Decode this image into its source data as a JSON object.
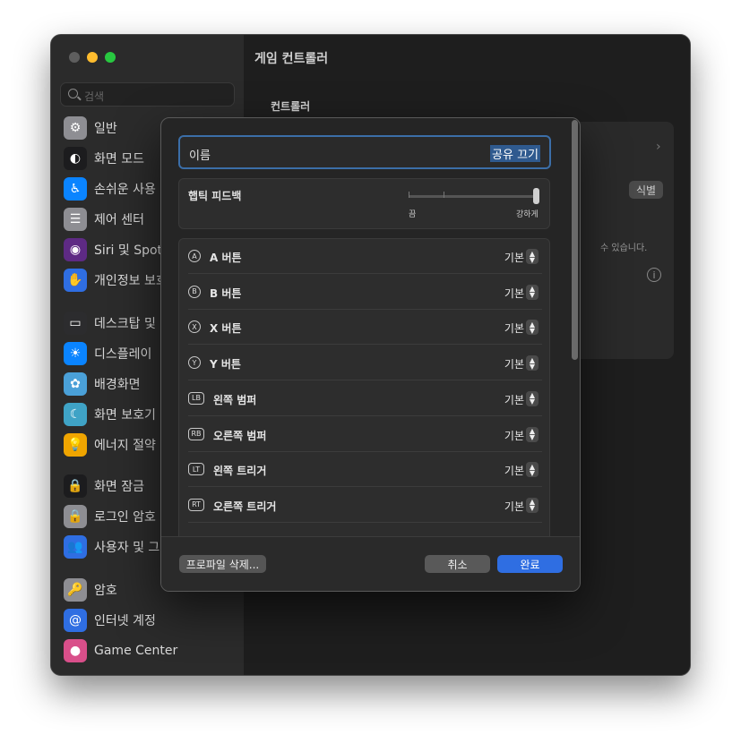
{
  "window": {
    "title": "게임 컨트롤러"
  },
  "sidebar": {
    "search_placeholder": "검색",
    "items": [
      {
        "label": "일반",
        "icon": "gear-icon",
        "color": "#8e8e93",
        "glyph": "⚙"
      },
      {
        "label": "화면 모드",
        "icon": "appearance-icon",
        "color": "#1c1c1e",
        "glyph": "◐"
      },
      {
        "label": "손쉬운 사용",
        "icon": "accessibility-icon",
        "color": "#0a84ff",
        "glyph": "♿"
      },
      {
        "label": "제어 센터",
        "icon": "control-center-icon",
        "color": "#8e8e93",
        "glyph": "☰"
      },
      {
        "label": "Siri 및 Spot",
        "icon": "siri-icon",
        "color": "#5e2a84",
        "glyph": "◉"
      },
      {
        "label": "개인정보 보호",
        "icon": "hand-icon",
        "color": "#2f6ee2",
        "glyph": "✋"
      },
      {
        "label": "데스크탑 및",
        "icon": "desktop-dock-icon",
        "color": "#2c2c2e",
        "glyph": "▭"
      },
      {
        "label": "디스플레이",
        "icon": "display-icon",
        "color": "#0a84ff",
        "glyph": "☀"
      },
      {
        "label": "배경화면",
        "icon": "wallpaper-icon",
        "color": "#4aa0d8",
        "glyph": "✿"
      },
      {
        "label": "화면 보호기",
        "icon": "screensaver-icon",
        "color": "#3fa3c6",
        "glyph": "☾"
      },
      {
        "label": "에너지 절약",
        "icon": "energy-icon",
        "color": "#f0a500",
        "glyph": "💡"
      },
      {
        "label": "화면 잠금",
        "icon": "lock-icon",
        "color": "#1c1c1e",
        "glyph": "🔒"
      },
      {
        "label": "로그인 암호",
        "icon": "login-password-icon",
        "color": "#8e8e93",
        "glyph": "🔒"
      },
      {
        "label": "사용자 및 그",
        "icon": "users-icon",
        "color": "#2f6ee2",
        "glyph": "👥"
      },
      {
        "label": "암호",
        "icon": "key-icon",
        "color": "#8e8e93",
        "glyph": "🔑"
      },
      {
        "label": "인터넷 계정",
        "icon": "at-icon",
        "color": "#2f6ee2",
        "glyph": "@"
      },
      {
        "label": "Game Center",
        "icon": "game-center-icon",
        "color": "#d94f8a",
        "glyph": "●"
      }
    ]
  },
  "main": {
    "section_label": "컨트롤러",
    "identify_button": "식별",
    "note": "수 있습니다."
  },
  "dialog": {
    "name_label": "이름",
    "name_value": "공유 끄기",
    "haptic": {
      "label": "햅틱 피드백",
      "min_label": "끔",
      "max_label": "강하게",
      "level_fraction": 1.0
    },
    "buttons": [
      {
        "glyph": "A",
        "name": "A 버튼",
        "value": "기본"
      },
      {
        "glyph": "B",
        "name": "B 버튼",
        "value": "기본"
      },
      {
        "glyph": "X",
        "name": "X 버튼",
        "value": "기본"
      },
      {
        "glyph": "Y",
        "name": "Y 버튼",
        "value": "기본"
      },
      {
        "glyph": "LB",
        "name": "왼쪽 범퍼",
        "value": "기본"
      },
      {
        "glyph": "RB",
        "name": "오른쪽 범퍼",
        "value": "기본"
      },
      {
        "glyph": "LT",
        "name": "왼쪽 트리거",
        "value": "기본"
      },
      {
        "glyph": "RT",
        "name": "오른쪽 트리거",
        "value": "기본"
      }
    ],
    "footer": {
      "delete_label": "프로파일 삭제...",
      "cancel_label": "취소",
      "done_label": "완료"
    }
  }
}
